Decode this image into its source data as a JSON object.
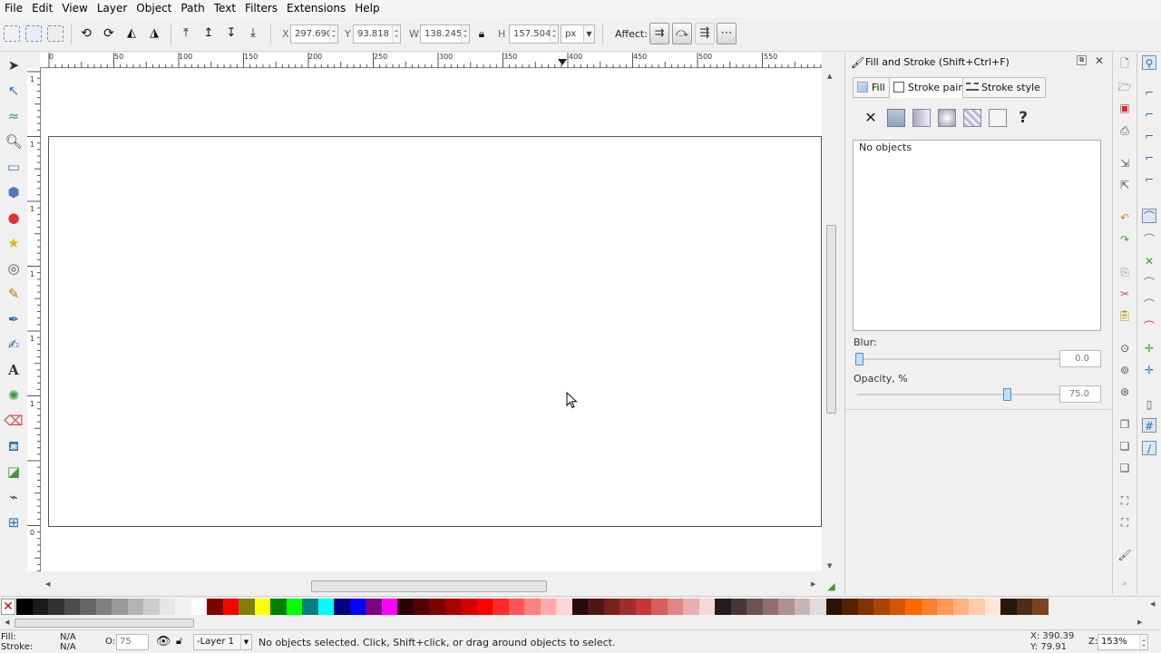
{
  "menubar": [
    "File",
    "Edit",
    "View",
    "Layer",
    "Object",
    "Path",
    "Text",
    "Filters",
    "Extensions",
    "Help"
  ],
  "toolbar": {
    "x_label": "X",
    "x_value": "297.690",
    "y_label": "Y",
    "y_value": "93.818",
    "w_label": "W",
    "w_value": "138.245",
    "h_label": "H",
    "h_value": "157.504",
    "unit": "px",
    "affect_label": "Affect:"
  },
  "ruler": {
    "h_labels": [
      "0",
      "50",
      "100",
      "150",
      "200",
      "250",
      "300",
      "350",
      "400",
      "450",
      "500",
      "550"
    ],
    "v_labels": [
      "1",
      "1",
      "1",
      "1",
      "1",
      "1",
      "0"
    ]
  },
  "dock": {
    "title": "Fill and Stroke (Shift+Ctrl+F)",
    "tabs": [
      "Fill",
      "Stroke paint",
      "Stroke style"
    ],
    "no_objects": "No objects",
    "blur_label": "Blur:",
    "blur_value": "0.0",
    "blur_level": 0,
    "opacity_label": "Opacity, %",
    "opacity_value": "75.0",
    "opacity_level": 0.75
  },
  "palette": {
    "colors": [
      "#000000",
      "#1a1a1a",
      "#333333",
      "#4d4d4d",
      "#666666",
      "#808080",
      "#999999",
      "#b3b3b3",
      "#cccccc",
      "#e6e6e6",
      "#f2f2f2",
      "#ffffff",
      "#800000",
      "#ff0000",
      "#808000",
      "#ffff00",
      "#008000",
      "#00ff00",
      "#008080",
      "#00ffff",
      "#000080",
      "#0000ff",
      "#800080",
      "#ff00ff",
      "#2b0000",
      "#550000",
      "#800000",
      "#aa0000",
      "#d40000",
      "#ff0000",
      "#ff2a2a",
      "#ff5555",
      "#ff8080",
      "#ffaaaa",
      "#ffd5d5",
      "#280b0b",
      "#501616",
      "#782121",
      "#a02c2c",
      "#c83737",
      "#d35f5f",
      "#de8787",
      "#e9afaf",
      "#f4d7d7",
      "#241c1c",
      "#483737",
      "#6c5353",
      "#916f6f",
      "#ac9393",
      "#c8b7b7",
      "#e3dbdb",
      "#2b1100",
      "#552200",
      "#803300",
      "#aa4400",
      "#d45500",
      "#ff6600",
      "#ff7f2a",
      "#ff9955",
      "#ffb380",
      "#ffccaa",
      "#ffe6d5",
      "#28170b",
      "#502d16",
      "#784421"
    ]
  },
  "status": {
    "fill_label": "Fill:",
    "fill_value": "N/A",
    "stroke_label": "Stroke:",
    "stroke_value": "N/A",
    "opacity_label": "O:",
    "opacity_value": "75",
    "layer": "-Layer 1",
    "message": "No objects selected. Click, Shift+click, or drag around objects to select.",
    "cursor_x": "X: 390.39",
    "cursor_y": "Y: 79.91",
    "zoom_label": "Z:",
    "zoom_value": "153%"
  }
}
